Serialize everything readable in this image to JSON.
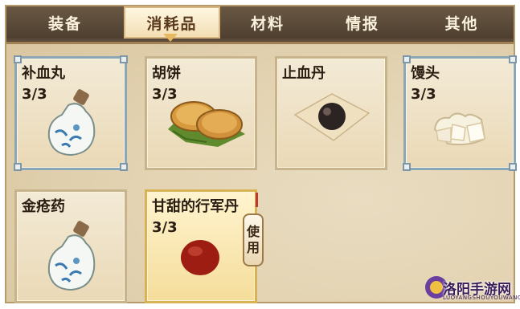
{
  "tabs": [
    {
      "label": "装备",
      "active": false
    },
    {
      "label": "消耗品",
      "active": true
    },
    {
      "label": "材料",
      "active": false
    },
    {
      "label": "情报",
      "active": false
    },
    {
      "label": "其他",
      "active": false
    }
  ],
  "items": [
    {
      "name": "补血丸",
      "count": "3/3",
      "icon": "medicine-bottle-icon"
    },
    {
      "name": "胡饼",
      "count": "3/3",
      "icon": "flatbread-icon"
    },
    {
      "name": "止血丹",
      "count": "",
      "icon": "black-pill-icon"
    },
    {
      "name": "馒头",
      "count": "3/3",
      "icon": "steamed-bun-icon"
    },
    {
      "name": "金疮药",
      "count": "",
      "icon": "medicine-bottle-icon"
    },
    {
      "name": "甘甜的行军丹",
      "count": "3/3",
      "icon": "red-pill-icon",
      "selected": true
    }
  ],
  "use_button": {
    "label": "使用"
  },
  "watermark": {
    "text": "洛阳手游网",
    "sub": "LUOYANGSHOUYOUWANG"
  }
}
